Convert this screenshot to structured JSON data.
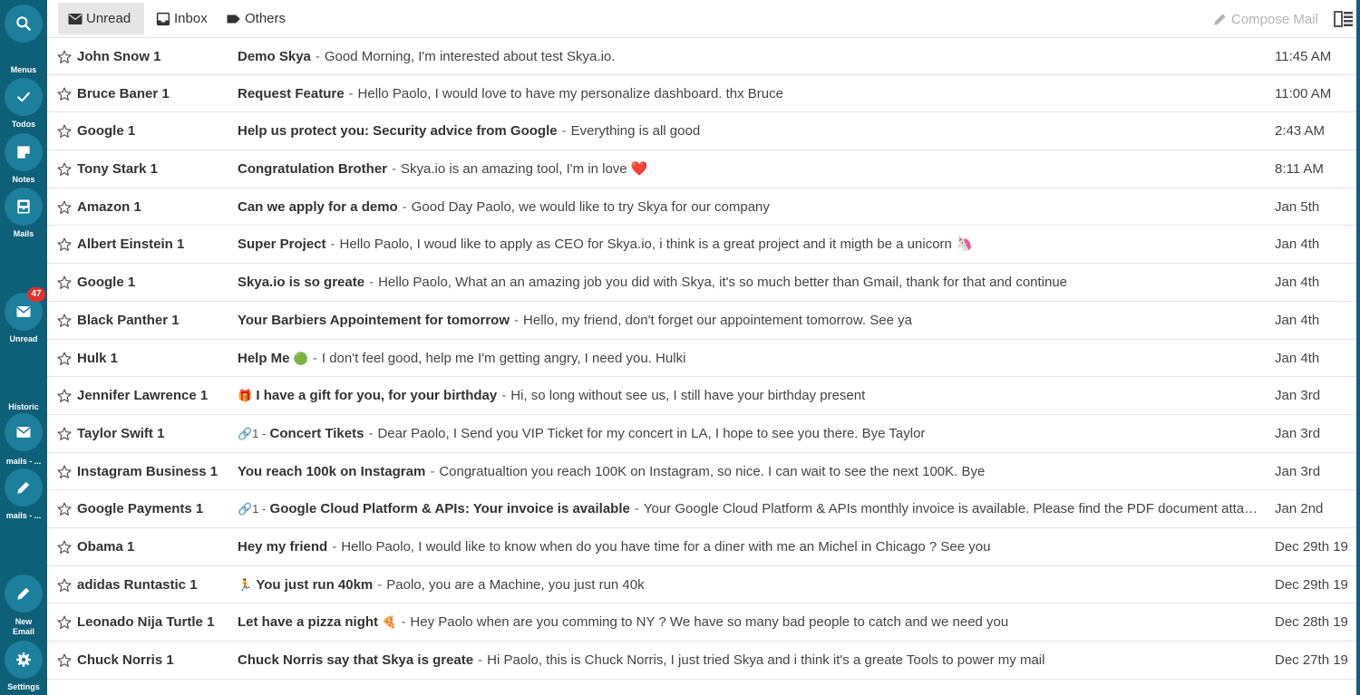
{
  "sidebar": {
    "search_label": "",
    "menus_label": "Menus",
    "todos_label": "Todos",
    "notes_label": "Notes",
    "mails_label": "Mails",
    "unread_label": "Unread",
    "unread_count": "47",
    "historic_label": "Historic",
    "historic_item1_label": "mails - ...",
    "historic_item2_label": "mails - ...",
    "new_email_label_line1": "New",
    "new_email_label_line2": "Email",
    "settings_label": "Settings",
    "colors": {
      "background": "#0e5f78",
      "button": "#1d7f9c",
      "badge": "#e2302d"
    }
  },
  "tabs": [
    {
      "label": "Unread",
      "active": true,
      "icon": "unread-mail-icon"
    },
    {
      "label": "Inbox",
      "active": false,
      "icon": "inbox-tray-icon"
    },
    {
      "label": "Others",
      "active": false,
      "icon": "tag-label-icon"
    }
  ],
  "toolbar": {
    "compose_label": "Compose Mail",
    "compose_icon": "pencil-icon",
    "layout_icon": "split-layout-icon"
  },
  "emails": [
    {
      "sender": "John Snow 1",
      "prefix": "",
      "subject": "Demo Skya",
      "suffix": "",
      "preview": "Good Morning, I'm interested about test Skya.io.",
      "date": "11:45 AM"
    },
    {
      "sender": "Bruce Baner 1",
      "prefix": "",
      "subject": "Request Feature",
      "suffix": "",
      "preview": "Hello Paolo, I would love to have my personalize dashboard. thx Bruce",
      "date": "11:00 AM"
    },
    {
      "sender": "Google 1",
      "prefix": "",
      "subject": "Help us protect you: Security advice from Google",
      "suffix": "",
      "preview": "Everything is all good",
      "date": "2:43 AM"
    },
    {
      "sender": "Tony Stark 1",
      "prefix": "",
      "subject": "Congratulation Brother",
      "suffix": "",
      "preview": "Skya.io is an amazing tool, I'm in love ❤️",
      "date": "8:11 AM"
    },
    {
      "sender": "Amazon 1",
      "prefix": "",
      "subject": "Can we apply for a demo",
      "suffix": "",
      "preview": "Good Day Paolo, we would like to try Skya for our company",
      "date": "Jan 5th"
    },
    {
      "sender": "Albert Einstein 1",
      "prefix": "",
      "subject": "Super Project",
      "suffix": "",
      "preview": "Hello Paolo, I woud like to apply as CEO for Skya.io, i think is a great project and it migth be a unicorn 🦄",
      "date": "Jan 4th"
    },
    {
      "sender": "Google 1",
      "prefix": "",
      "subject": "Skya.io is so greate",
      "suffix": "",
      "preview": "Hello Paolo, What an an amazing job you did with Skya, it's so much better than Gmail, thank for that and continue",
      "date": "Jan 4th"
    },
    {
      "sender": "Black Panther 1",
      "prefix": "",
      "subject": "Your Barbiers Appointement for tomorrow",
      "suffix": "",
      "preview": "Hello, my friend, don't forget our appointement tomorrow. See ya",
      "date": "Jan 4th"
    },
    {
      "sender": "Hulk 1",
      "prefix": "",
      "subject": "Help Me",
      "suffix": "🟢",
      "preview": "I don't feel good, help me I'm getting angry, I need you. Hulki",
      "date": "Jan 4th"
    },
    {
      "sender": "Jennifer Lawrence 1",
      "prefix": "🎁",
      "subject": "I have a gift for you, for your birthday",
      "suffix": "",
      "preview": "Hi, so long without see us, I still have your birthday present",
      "date": "Jan 3rd"
    },
    {
      "sender": "Taylor Swift 1",
      "prefix": "🔗1 -",
      "subject": "Concert Tikets",
      "suffix": "",
      "preview": "Dear Paolo, I Send you VIP Ticket for my concert in LA, I hope to see you there. Bye Taylor",
      "date": "Jan 3rd"
    },
    {
      "sender": "Instagram Business 1",
      "prefix": "",
      "subject": "You reach 100k on Instagram",
      "suffix": "",
      "preview": "Congratualtion you reach 100K on Instagram, so nice. I can wait to see the next 100K. Bye",
      "date": "Jan 3rd"
    },
    {
      "sender": "Google Payments 1",
      "prefix": "🔗1 -",
      "subject": "Google Cloud Platform & APIs: Your invoice is available",
      "suffix": "",
      "preview": "Your Google Cloud Platform & APIs monthly invoice is available. Please find the PDF document attached at the bottom of this email.",
      "date": "Jan 2nd"
    },
    {
      "sender": "Obama 1",
      "prefix": "",
      "subject": "Hey my friend",
      "suffix": "",
      "preview": "Hello Paolo, I would like to know when do you have time for a diner with me an Michel in Chicago ? See you",
      "date": "Dec 29th 19"
    },
    {
      "sender": "adidas Runtastic 1",
      "prefix": "🏃",
      "subject": "You just run 40km",
      "suffix": "",
      "preview": "Paolo, you are a Machine, you just run 40k",
      "date": "Dec 29th 19"
    },
    {
      "sender": "Leonado Nija Turtle 1",
      "prefix": "",
      "subject": "Let have a pizza night",
      "suffix": "🍕",
      "preview": "Hey Paolo when are you comming to NY ? We have so many bad people to catch and we need you",
      "date": "Dec 28th 19"
    },
    {
      "sender": "Chuck Norris 1",
      "prefix": "",
      "subject": "Chuck Norris say that Skya is greate",
      "suffix": "",
      "preview": "Hi Paolo, this is Chuck Norris, I just tried Skya and i think it's a greate Tools to power my mail",
      "date": "Dec 27th 19"
    }
  ]
}
